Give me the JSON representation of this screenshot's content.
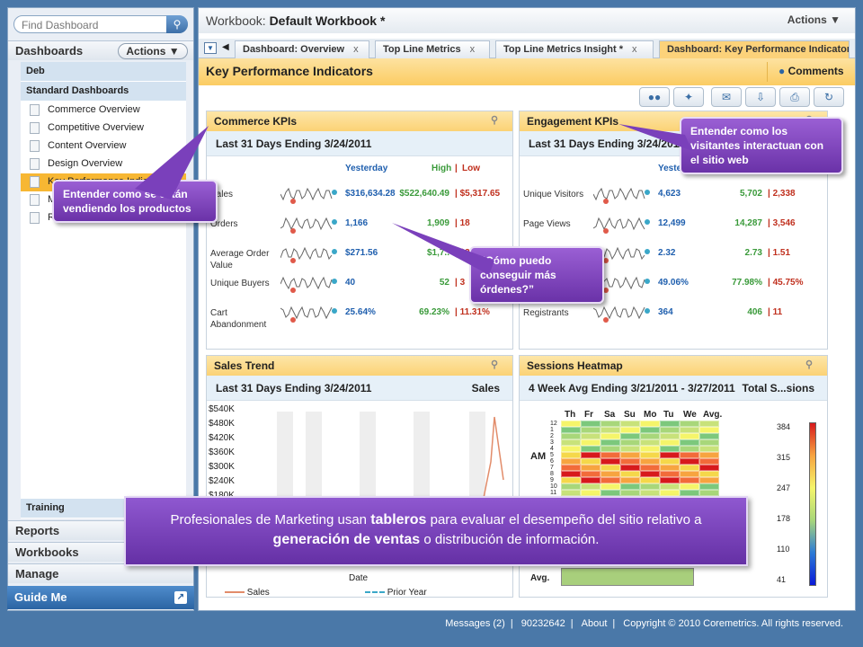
{
  "sidebar": {
    "search_placeholder": "Find Dashboard",
    "dashboards_label": "Dashboards",
    "actions_label": "Actions ▼",
    "group1": "Deb",
    "group2": "Standard Dashboards",
    "items": [
      {
        "label": "Commerce Overview"
      },
      {
        "label": "Competitive Overview"
      },
      {
        "label": "Content Overview"
      },
      {
        "label": "Design Overview"
      },
      {
        "label": "Key Performance Indicators"
      },
      {
        "label": "M"
      },
      {
        "label": "R"
      }
    ],
    "training": "Training",
    "reports": "Reports",
    "workbooks": "Workbooks",
    "manage": "Manage",
    "guide_me": "Guide Me"
  },
  "workbook": {
    "prefix": "Workbook:",
    "name": "Default Workbook *",
    "actions": "Actions ▼"
  },
  "tabs": [
    {
      "label": "Dashboard: Overview"
    },
    {
      "label": "Top Line Metrics"
    },
    {
      "label": "Top Line Metrics Insight *"
    },
    {
      "label": "Dashboard: Key Performance Indicator"
    }
  ],
  "kpi_title": "Key Performance Indicators",
  "comments": "Comments",
  "commerce": {
    "title": "Commerce KPIs",
    "subtitle": "Last 31 Days Ending 3/24/2011",
    "col_yesterday": "Yesterday",
    "col_high": "High",
    "col_low": "Low",
    "sep": "|",
    "rows": [
      {
        "label": "Sales",
        "y": "$316,634.28",
        "h": "$522,640.49",
        "l": "$5,317.65"
      },
      {
        "label": "Orders",
        "y": "1,166",
        "h": "1,909",
        "l": "18"
      },
      {
        "label": "Average Order Value",
        "y": "$271.56",
        "h": "$1,7..",
        "l": "$25..."
      },
      {
        "label": "Unique Buyers",
        "y": "40",
        "h": "52",
        "l": "3"
      },
      {
        "label": "Cart Abandonment",
        "y": "25.64%",
        "h": "69.23%",
        "l": "11.31%"
      }
    ]
  },
  "engagement": {
    "title": "Engagement KPIs",
    "subtitle": "Last 31 Days Ending 3/24/2011",
    "col_yesterday": "Yesterday",
    "rows": [
      {
        "label": "Unique Visitors",
        "y": "4,623",
        "h": "5,702",
        "l": "2,338"
      },
      {
        "label": "Page Views",
        "y": "12,499",
        "h": "14,287",
        "l": "3,546"
      },
      {
        "label": "Page Views...",
        "y": "2.32",
        "h": "2.73",
        "l": "1.51"
      },
      {
        "label": "...",
        "y": "49.06%",
        "h": "77.98%",
        "l": "45.75%"
      },
      {
        "label": "Registrants",
        "y": "364",
        "h": "406",
        "l": "11"
      }
    ]
  },
  "sales_trend": {
    "title": "Sales Trend",
    "subtitle": "Last 31 Days Ending 3/24/2011",
    "metric": "Sales",
    "yticks": [
      "$540K",
      "$480K",
      "$420K",
      "$360K",
      "$300K",
      "$240K",
      "$180K"
    ],
    "xlabel": "Date",
    "legend_sales": "Sales",
    "legend_prior": "Prior Year"
  },
  "heatmap": {
    "title": "Sessions Heatmap",
    "subtitle": "4 Week Avg Ending 3/21/2011 - 3/27/2011",
    "metric": "Total S...sions",
    "days": [
      "Th",
      "Fr",
      "Sa",
      "Su",
      "Mo",
      "Tu",
      "We",
      "Avg."
    ],
    "am": "AM",
    "avg": "Avg.",
    "scale": [
      "384",
      "315",
      "247",
      "178",
      "110",
      "41"
    ],
    "hours": [
      "12",
      "1",
      "2",
      "3",
      "4",
      "5",
      "6",
      "7",
      "8",
      "9",
      "10",
      "11"
    ]
  },
  "callouts": {
    "commerce": "Entender como se están vendiendo los productos",
    "engagement": "Entender como los visitantes interactuan con el sitio web",
    "orders": "“Cómo puedo conseguir más órdenes?”"
  },
  "banner": {
    "t1": "Profesionales de Marketing usan ",
    "b1": "tableros",
    "t2": " para evaluar el desempeño del sitio relativo a ",
    "b2": "generación de ventas",
    "t3": " o distribución de información."
  },
  "footer": {
    "messages": "Messages (2)",
    "id": "90232642",
    "about": "About",
    "copyright": "Copyright © 2010 Coremetrics. All rights reserved."
  },
  "colors": {
    "accent": "#fbcc63",
    "callout": "#7a40bb",
    "high": "#3a9a3a",
    "low": "#c0301e",
    "value": "#1f5fae"
  }
}
